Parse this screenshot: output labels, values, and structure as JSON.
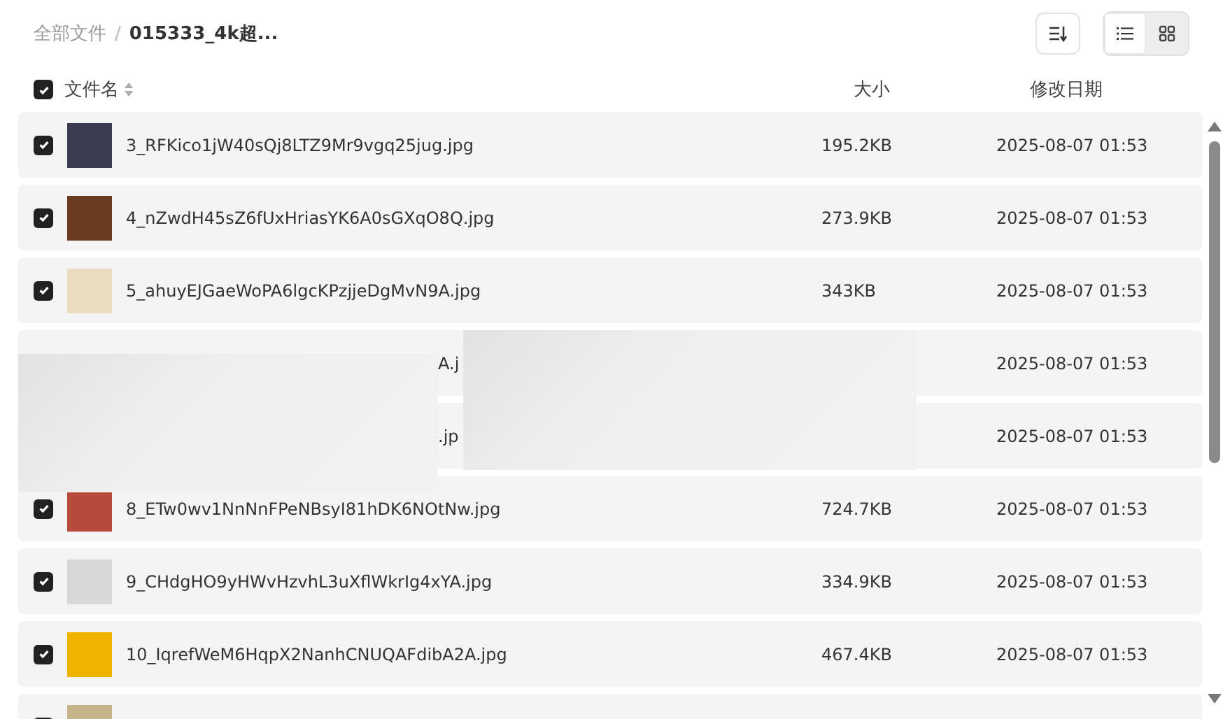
{
  "breadcrumb": [
    {
      "label": "全部文件",
      "current": false
    },
    {
      "label": "015333_4k超...",
      "current": true
    }
  ],
  "breadcrumb_separator": "/",
  "toolbar": {
    "view_modes": [
      {
        "kind": "list",
        "selected": true
      },
      {
        "kind": "grid",
        "selected": false
      }
    ]
  },
  "table": {
    "select_all": {
      "checked": true
    },
    "columns": [
      {
        "label": "文件名",
        "sortable": true
      },
      {
        "label": "大小",
        "sortable": false
      },
      {
        "label": "修改日期",
        "sortable": false
      }
    ],
    "rows": [
      {
        "kind": "file",
        "checked": true,
        "name": "3_RFKico1jW40sQj8LTZ9Mr9vgq25jug.jpg",
        "size": "195.2KB",
        "modified": "2025-08-07 01:53"
      },
      {
        "kind": "file",
        "checked": true,
        "name": "4_nZwdH45sZ6fUxHriasYK6A0sGXqO8Q.jpg",
        "size": "273.9KB",
        "modified": "2025-08-07 01:53"
      },
      {
        "kind": "file",
        "checked": true,
        "name": "5_ahuyEJGaeWoPA6lgcKPzjjeDgMvN9A.jpg",
        "size": "343KB",
        "modified": "2025-08-07 01:53"
      },
      {
        "kind": "obscured",
        "name": "A.j",
        "modified": "2025-08-07 01:53"
      },
      {
        "kind": "obscured",
        "name": ".jp",
        "modified": "2025-08-07 01:53"
      },
      {
        "kind": "file",
        "checked": true,
        "name": "8_ETw0wv1NnNnFPeNBsyI81hDK6NOtNw.jpg",
        "size": "724.7KB",
        "modified": "2025-08-07 01:53"
      },
      {
        "kind": "file",
        "checked": true,
        "name": "9_CHdgHO9yHWvHzvhL3uXflWkrIg4xYA.jpg",
        "size": "334.9KB",
        "modified": "2025-08-07 01:53"
      },
      {
        "kind": "file",
        "checked": true,
        "name": "10_IqrefWeM6HqpX2NanhCNUQAFdibA2A.jpg",
        "size": "467.4KB",
        "modified": "2025-08-07 01:53"
      },
      {
        "kind": "cut",
        "checked": true
      }
    ]
  }
}
